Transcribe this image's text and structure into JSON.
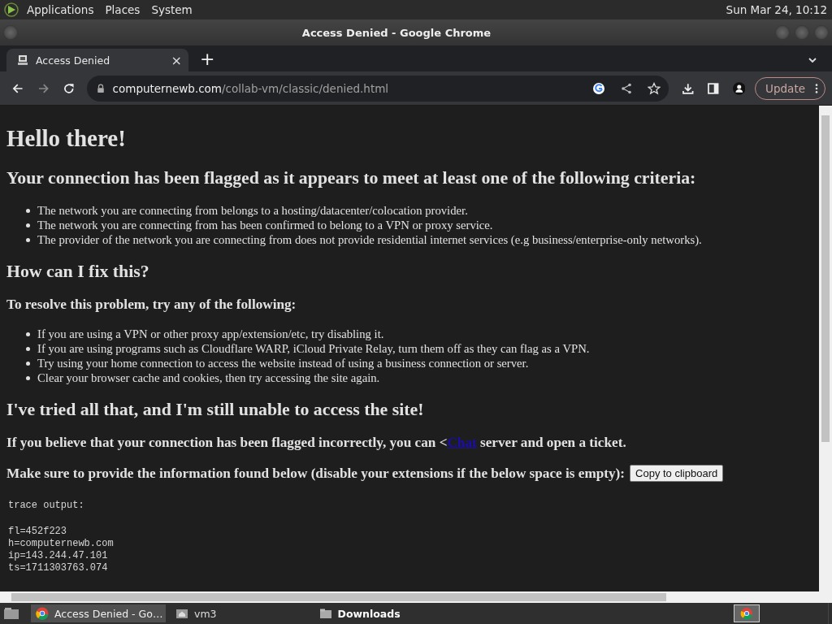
{
  "top_panel": {
    "menus": [
      "Applications",
      "Places",
      "System"
    ],
    "clock": "Sun Mar 24, 10:12"
  },
  "window": {
    "title": "Access Denied - Google Chrome"
  },
  "tabs": [
    {
      "label": "Access Denied",
      "selected": true,
      "close": "×"
    }
  ],
  "new_tab": "+",
  "toolbar": {
    "url_host": "computernewb.com",
    "url_path": "/collab-vm/classic/denied.html",
    "update_button": "Update"
  },
  "page": {
    "blocks": [
      {
        "kind": "h1",
        "text": "Hello there!"
      },
      {
        "kind": "h2",
        "text": "Your connection has been flagged as it appears to meet at least one of the following criteria:"
      },
      {
        "kind": "list",
        "items": [
          "The network you are connecting from belongs to a hosting/datacenter/colocation provider.",
          "The network you are connecting from has been confirmed to belong to a VPN or proxy service.",
          "The provider of the network you are connecting from does not provide residential internet services (e.g business/enterprise-only networks)."
        ]
      },
      {
        "kind": "h2",
        "text": "How can I fix this?"
      },
      {
        "kind": "h3",
        "text": "To resolve this problem, try any of the following:"
      },
      {
        "kind": "list",
        "items": [
          "If you are using a VPN or other proxy app/extension/etc, try disabling it.",
          "If you are using programs such as Cloudflare WARP, iCloud Private Relay, turn them off as they can flag as a VPN.",
          "Try using your home connection to access the website instead of using a business connection or server.",
          "Clear your browser cache and cookies, then try accessing the site again."
        ]
      },
      {
        "kind": "h2",
        "text": "I've tried all that, and I'm still unable to access the site!"
      },
      {
        "kind": "link_line",
        "before": "If you believe that your connection has been flagged incorrectly, you can <",
        "link": "Chat",
        "after": " server and open a ticket."
      },
      {
        "kind": "copy_line",
        "text": "Make sure to provide the information found below (disable your extensions if the below space is empty):",
        "button": "Copy to clipboard"
      },
      {
        "kind": "trace",
        "title": "trace output:",
        "lines": [
          "fl=452f223",
          "h=computernewb.com",
          "ip=143.244.47.101",
          "ts=1711303763.074"
        ]
      }
    ]
  },
  "taskbar": {
    "items": [
      {
        "label": "Access Denied - Go…",
        "kind": "browser",
        "selected": true,
        "bold": false
      },
      {
        "label": "vm3",
        "kind": "home",
        "selected": false,
        "bold": false
      },
      {
        "label": "Downloads",
        "kind": "folder",
        "selected": false,
        "bold": true
      }
    ]
  }
}
